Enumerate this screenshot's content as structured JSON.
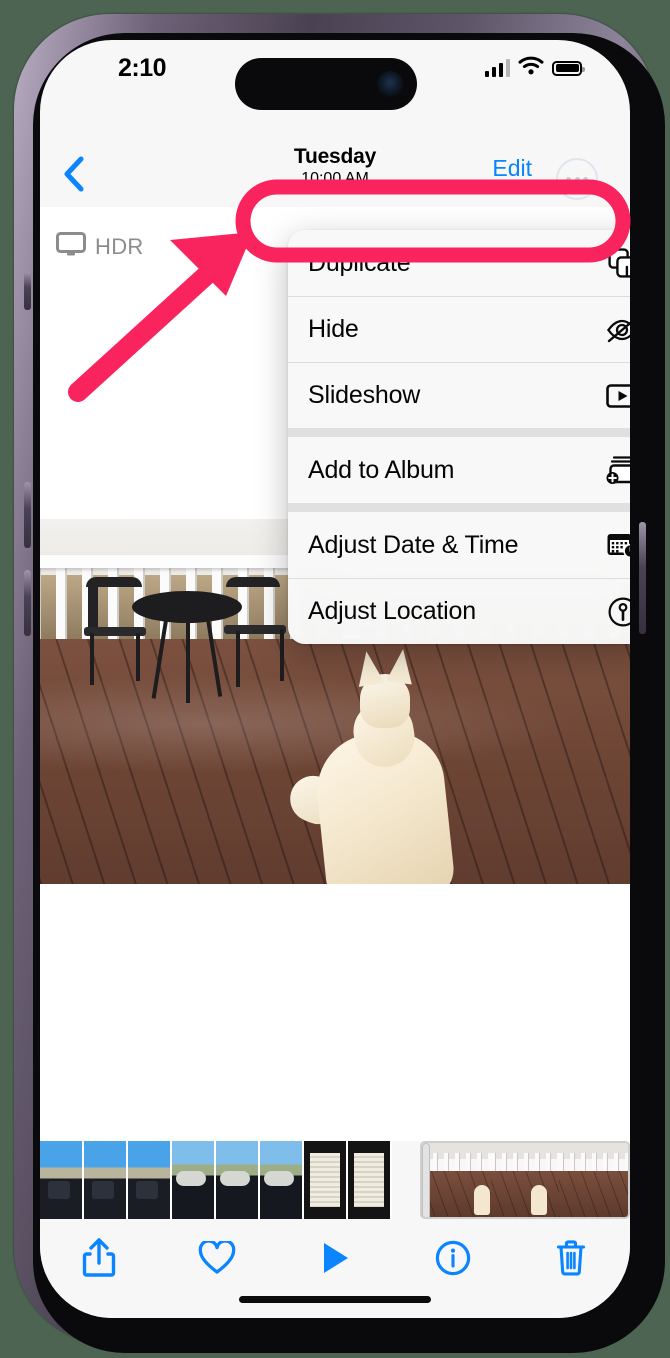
{
  "device": {
    "model": "iPhone",
    "frame_color": "#5a5165"
  },
  "status_bar": {
    "time": "2:10",
    "cellular_icon": "signal-bars-icon",
    "wifi_icon": "wifi-icon",
    "battery_icon": "battery-icon"
  },
  "nav_bar": {
    "back_icon": "back-chevron-icon",
    "title": "Tuesday",
    "subtitle": "10:00 AM",
    "edit_label": "Edit",
    "more_icon": "ellipsis-circle-icon"
  },
  "viewer": {
    "hdr_badge": {
      "icon": "display-icon",
      "label": "HDR"
    }
  },
  "context_menu": {
    "groups": [
      {
        "items": [
          {
            "label": "Duplicate",
            "icon": "duplicate-icon",
            "highlighted": true
          },
          {
            "label": "Hide",
            "icon": "eye-slash-icon",
            "highlighted": false
          },
          {
            "label": "Slideshow",
            "icon": "slideshow-play-icon",
            "highlighted": false
          }
        ]
      },
      {
        "items": [
          {
            "label": "Add to Album",
            "icon": "add-to-album-icon",
            "highlighted": false
          }
        ]
      },
      {
        "items": [
          {
            "label": "Adjust Date & Time",
            "icon": "calendar-clock-icon",
            "highlighted": false
          },
          {
            "label": "Adjust Location",
            "icon": "location-pin-icon",
            "highlighted": false
          }
        ]
      }
    ]
  },
  "toolbar": {
    "buttons": [
      {
        "name": "share-button",
        "icon": "share-icon"
      },
      {
        "name": "favorite-button",
        "icon": "heart-icon"
      },
      {
        "name": "play-button",
        "icon": "play-icon"
      },
      {
        "name": "info-button",
        "icon": "info-circle-icon"
      },
      {
        "name": "delete-button",
        "icon": "trash-icon"
      }
    ],
    "accent_color": "#0a84ff"
  },
  "annotation": {
    "type": "arrow-and-highlight",
    "color": "#f9245e",
    "target_label": "Duplicate"
  },
  "colors": {
    "accent_blue": "#0a84ff",
    "annotation_pink": "#f9245e",
    "menu_background": "#f8f8f8",
    "screen_background": "#f7f7f7",
    "page_background": "#4e6453"
  }
}
